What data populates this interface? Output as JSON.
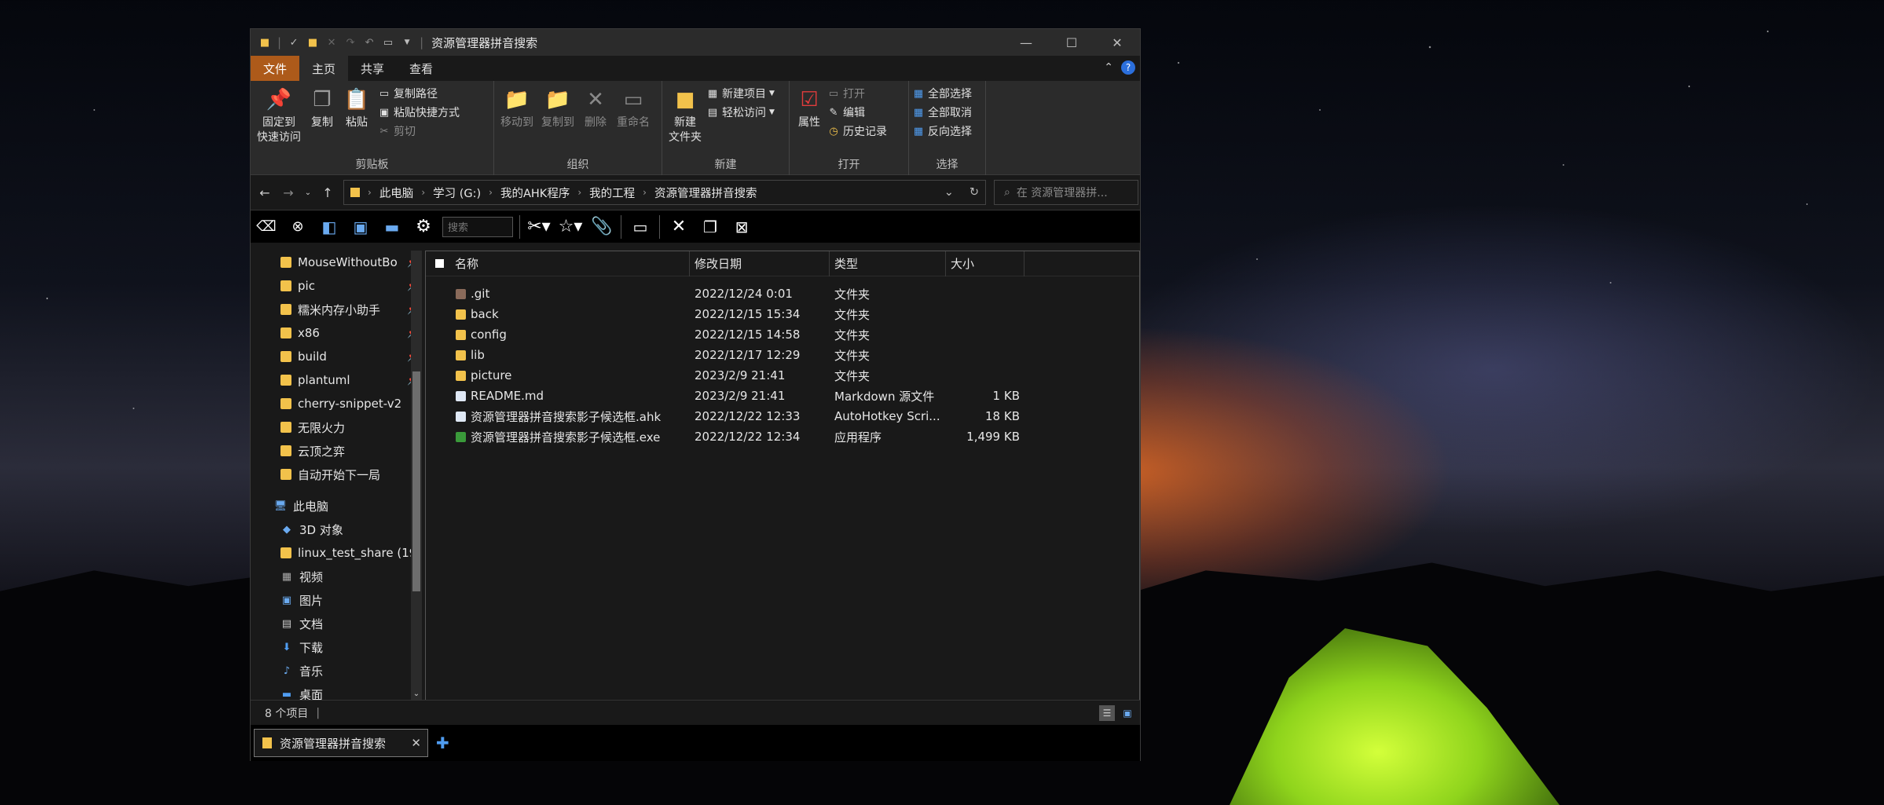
{
  "window": {
    "title": "资源管理器拼音搜索"
  },
  "ribbon_tabs": [
    "文件",
    "主页",
    "共享",
    "查看"
  ],
  "ribbon": {
    "clipboard": {
      "label": "剪贴板",
      "pin_line1": "固定到",
      "pin_line2": "快速访问",
      "copy": "复制",
      "paste": "粘贴",
      "copy_path": "复制路径",
      "paste_shortcut": "粘贴快捷方式",
      "cut": "剪切"
    },
    "organize": {
      "label": "组织",
      "move_to": "移动到",
      "copy_to": "复制到",
      "delete": "删除",
      "rename": "重命名"
    },
    "new": {
      "label": "新建",
      "new_folder_line1": "新建",
      "new_folder_line2": "文件夹",
      "new_item": "新建项目",
      "easy_access": "轻松访问"
    },
    "open": {
      "label": "打开",
      "properties": "属性",
      "open": "打开",
      "edit": "编辑",
      "history": "历史记录"
    },
    "select": {
      "label": "选择",
      "select_all": "全部选择",
      "select_none": "全部取消",
      "invert": "反向选择"
    }
  },
  "address": {
    "breadcrumbs": [
      "此电脑",
      "学习 (G:)",
      "我的AHK程序",
      "我的工程",
      "资源管理器拼音搜索"
    ],
    "search_placeholder": "在 资源管理器拼..."
  },
  "toolbar2": {
    "search_placeholder": "搜索"
  },
  "sidebar": {
    "quick_access": [
      {
        "label": "MouseWithoutBo",
        "pinned": true
      },
      {
        "label": "pic",
        "pinned": true
      },
      {
        "label": "糯米内存小助手",
        "pinned": true
      },
      {
        "label": "x86",
        "pinned": true
      },
      {
        "label": "build",
        "pinned": true
      },
      {
        "label": "plantuml",
        "pinned": true
      },
      {
        "label": "cherry-snippet-v2",
        "pinned": false
      },
      {
        "label": "无限火力",
        "pinned": false
      },
      {
        "label": "云顶之弈",
        "pinned": false
      },
      {
        "label": "自动开始下一局",
        "pinned": false
      }
    ],
    "this_pc": "此电脑",
    "pc_items": [
      "3D 对象",
      "linux_test_share (19",
      "视频",
      "图片",
      "文档",
      "下载",
      "音乐",
      "桌面"
    ]
  },
  "columns": {
    "name": "名称",
    "modified": "修改日期",
    "type": "类型",
    "size": "大小"
  },
  "files": [
    {
      "name": ".git",
      "modified": "2022/12/24 0:01",
      "type": "文件夹",
      "size": "",
      "icon": "git-folder-icon"
    },
    {
      "name": "back",
      "modified": "2022/12/15 15:34",
      "type": "文件夹",
      "size": "",
      "icon": "folder-icon"
    },
    {
      "name": "config",
      "modified": "2022/12/15 14:58",
      "type": "文件夹",
      "size": "",
      "icon": "folder-icon"
    },
    {
      "name": "lib",
      "modified": "2022/12/17 12:29",
      "type": "文件夹",
      "size": "",
      "icon": "folder-icon"
    },
    {
      "name": "picture",
      "modified": "2023/2/9 21:41",
      "type": "文件夹",
      "size": "",
      "icon": "folder-icon"
    },
    {
      "name": "README.md",
      "modified": "2023/2/9 21:41",
      "type": "Markdown 源文件",
      "size": "1 KB",
      "icon": "markdown-file-icon"
    },
    {
      "name": "资源管理器拼音搜索影子候选框.ahk",
      "modified": "2022/12/22 12:33",
      "type": "AutoHotkey Scri...",
      "size": "18 KB",
      "icon": "ahk-file-icon"
    },
    {
      "name": "资源管理器拼音搜索影子候选框.exe",
      "modified": "2022/12/22 12:34",
      "type": "应用程序",
      "size": "1,499 KB",
      "icon": "exe-file-icon"
    }
  ],
  "status": {
    "item_count": "8 个项目"
  },
  "tab": {
    "label": "资源管理器拼音搜索"
  }
}
